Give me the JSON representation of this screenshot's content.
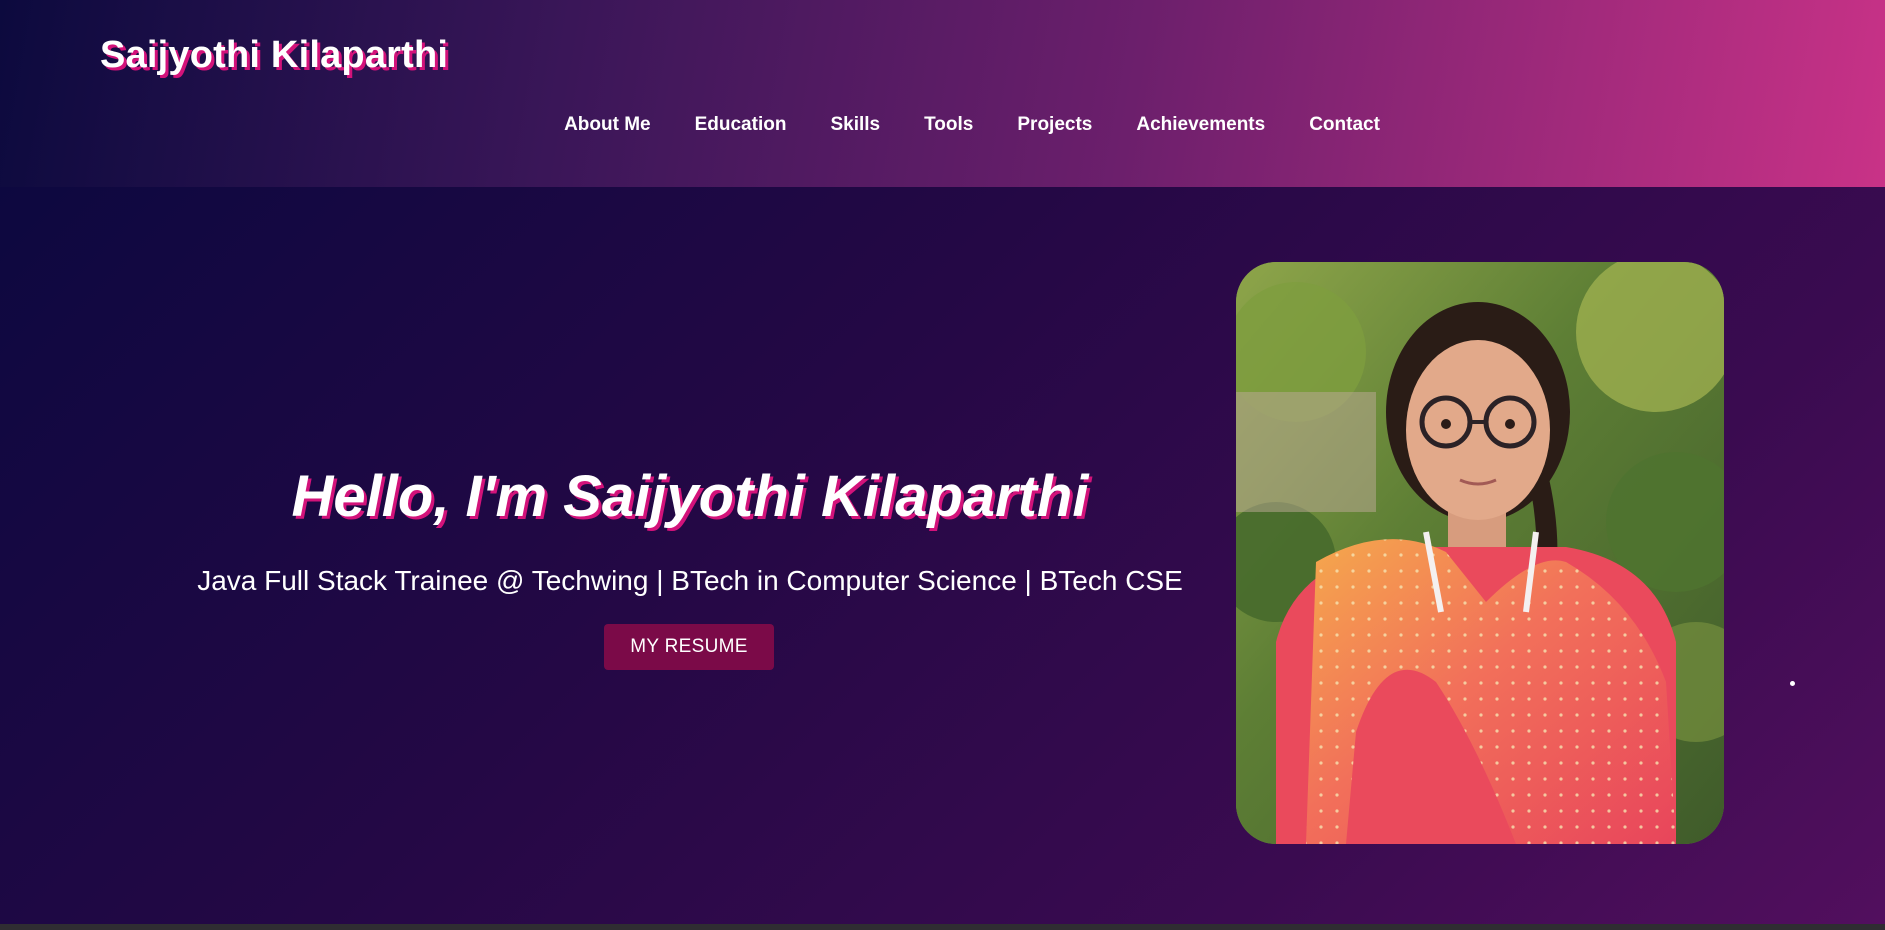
{
  "header": {
    "brand": "Saijyothi Kilaparthi",
    "nav": [
      {
        "label": "About Me"
      },
      {
        "label": "Education"
      },
      {
        "label": "Skills"
      },
      {
        "label": "Tools"
      },
      {
        "label": "Projects"
      },
      {
        "label": "Achievements"
      },
      {
        "label": "Contact"
      }
    ]
  },
  "hero": {
    "title": "Hello, I'm Saijyothi Kilaparthi",
    "subtitle": "Java Full Stack Trainee @ Techwing | BTech in Computer Science | BTech CSE",
    "resume_button": "MY RESUME",
    "photo_icon": "profile-photo"
  },
  "colors": {
    "header_start": "#0c0a3e",
    "header_end": "#c93287",
    "hero_bg": "#240845",
    "accent_shadow": "#d3127a",
    "button_bg": "#7b0a48"
  }
}
